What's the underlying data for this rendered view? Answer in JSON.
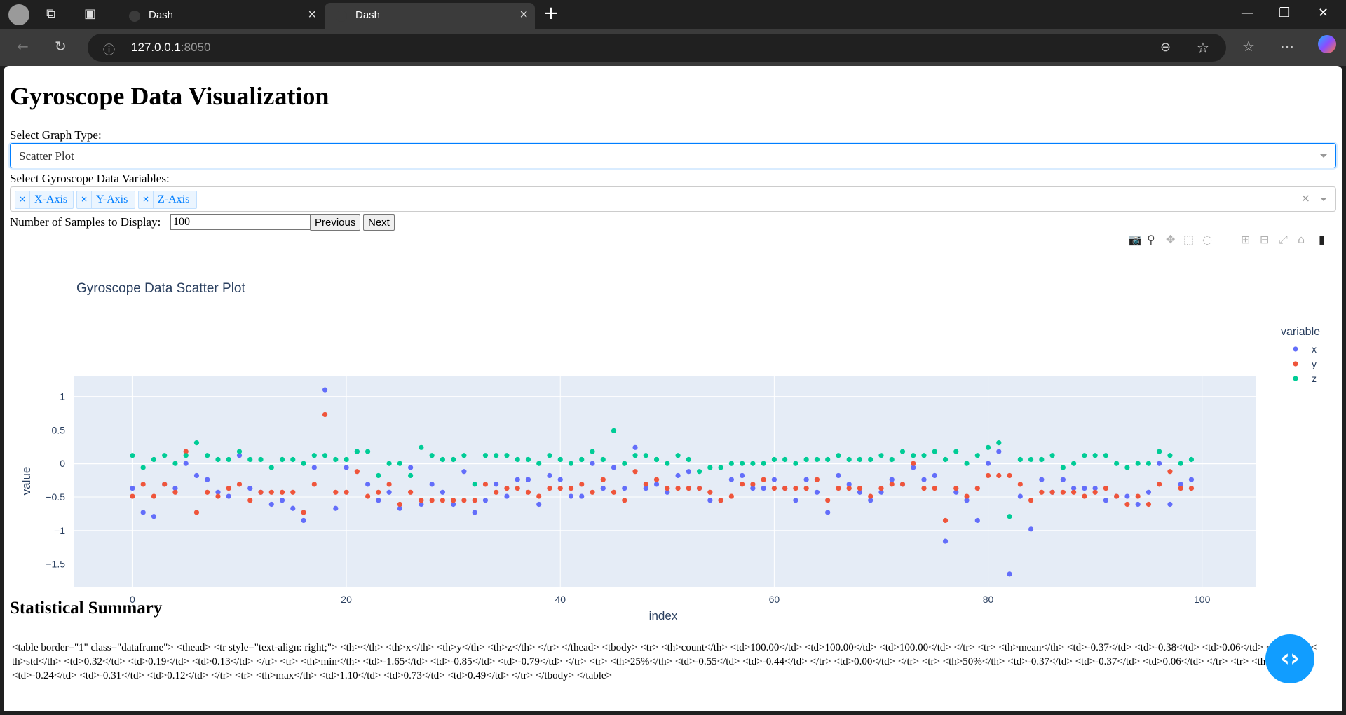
{
  "browser": {
    "tabs": [
      {
        "label": "Dash"
      },
      {
        "label": "Dash"
      }
    ],
    "url_host": "127.0.0.1",
    "url_port": ":8050"
  },
  "page": {
    "title": "Gyroscope Data Visualization",
    "graph_type_label": "Select Graph Type:",
    "graph_type_value": "Scatter Plot",
    "variables_label": "Select Gyroscope Data Variables:",
    "variables": [
      "X-Axis",
      "Y-Axis",
      "Z-Axis"
    ],
    "samples_label": "Number of Samples to Display:",
    "samples_value": "100",
    "previous_label": "Previous",
    "next_label": "Next",
    "summary_title": "Statistical Summary",
    "summary_raw": "<table border=\"1\" class=\"dataframe\"> <thead> <tr style=\"text-align: right;\"> <th></th> <th>x</th> <th>y</th> <th>z</th> </tr> </thead> <tbody> <tr> <th>count</th> <td>100.00</td> <td>100.00</td> <td>100.00</td> </tr> <tr> <th>mean</th> <td>-0.37</td> <td>-0.38</td> <td>0.06</td> </tr> <tr> <th>std</th> <td>0.32</td> <td>0.19</td> <td>0.13</td> </tr> <tr> <th>min</th> <td>-1.65</td> <td>-0.85</td> <td>-0.79</td> </tr> <tr> <th>25%</th> <td>-0.55</td> <td>-0.44</td> </tr> <td>0.00</td> </tr> <tr> <th>50%</th> <td>-0.37</td> <td>-0.37</td> <td>0.06</td> </tr> <tr> <th>75%</th> <td>-0.24</td> <td>-0.31</td> <td>0.12</td> </tr> <tr> <th>max</th> <td>1.10</td> <td>0.73</td> <td>0.49</td> </tr> </tbody> </table>"
  },
  "chart_data": {
    "type": "scatter",
    "title": "Gyroscope Data Scatter Plot",
    "xlabel": "index",
    "ylabel": "value",
    "xlim": [
      -5.5,
      105
    ],
    "ylim": [
      -1.85,
      1.3
    ],
    "xticks": [
      0,
      20,
      40,
      60,
      80,
      100
    ],
    "yticks": [
      1,
      0.5,
      0,
      -0.5,
      -1,
      -1.5
    ],
    "ytick_labels": [
      "1",
      "0.5",
      "0",
      "−0.5",
      "−1",
      "−1.5"
    ],
    "legend_title": "variable",
    "legend_position": "right",
    "grid": true,
    "colors": {
      "x": "#636efa",
      "y": "#ef553b",
      "z": "#00cc96",
      "plot_bg": "#e5ecf6"
    },
    "x": [
      0,
      1,
      2,
      3,
      4,
      5,
      6,
      7,
      8,
      9,
      10,
      11,
      12,
      13,
      14,
      15,
      16,
      17,
      18,
      19,
      20,
      21,
      22,
      23,
      24,
      25,
      26,
      27,
      28,
      29,
      30,
      31,
      32,
      33,
      34,
      35,
      36,
      37,
      38,
      39,
      40,
      41,
      42,
      43,
      44,
      45,
      46,
      47,
      48,
      49,
      50,
      51,
      52,
      53,
      54,
      55,
      56,
      57,
      58,
      59,
      60,
      61,
      62,
      63,
      64,
      65,
      66,
      67,
      68,
      69,
      70,
      71,
      72,
      73,
      74,
      75,
      76,
      77,
      78,
      79,
      80,
      81,
      82,
      83,
      84,
      85,
      86,
      87,
      88,
      89,
      90,
      91,
      92,
      93,
      94,
      95,
      96,
      97,
      98,
      99
    ],
    "series": [
      {
        "name": "x",
        "values": [
          -0.37,
          -0.73,
          -0.79,
          -0.31,
          -0.37,
          0.0,
          -0.18,
          -0.24,
          -0.43,
          -0.49,
          0.12,
          -0.37,
          -0.43,
          -0.61,
          -0.55,
          -0.67,
          -0.85,
          -0.06,
          1.1,
          -0.67,
          -0.06,
          0.18,
          -0.31,
          -0.55,
          -0.43,
          -0.67,
          -0.06,
          -0.61,
          -0.31,
          -0.43,
          -0.61,
          -0.12,
          -0.73,
          -0.55,
          -0.31,
          -0.49,
          -0.24,
          -0.24,
          -0.61,
          -0.18,
          -0.24,
          -0.49,
          -0.49,
          0.0,
          -0.37,
          -0.06,
          -0.37,
          0.24,
          -0.37,
          -0.31,
          -0.43,
          -0.18,
          -0.12,
          -0.37,
          -0.55,
          -0.55,
          -0.24,
          -0.18,
          -0.37,
          -0.37,
          -0.24,
          -0.37,
          -0.55,
          -0.24,
          -0.43,
          -0.73,
          -0.18,
          -0.31,
          -0.43,
          -0.55,
          -0.43,
          -0.24,
          -0.31,
          -0.06,
          -0.24,
          -0.18,
          -1.16,
          -0.43,
          -0.55,
          -0.85,
          0.0,
          0.18,
          -1.65,
          -0.49,
          -0.98,
          -0.24,
          -0.43,
          -0.24,
          -0.37,
          -0.37,
          -0.37,
          -0.55,
          -0.49,
          -0.49,
          -0.61,
          -0.43,
          0.0,
          -0.61,
          -0.31,
          -0.24
        ]
      },
      {
        "name": "y",
        "values": [
          -0.49,
          -0.31,
          -0.49,
          -0.31,
          -0.43,
          0.18,
          -0.73,
          -0.43,
          -0.49,
          -0.37,
          -0.31,
          -0.55,
          -0.43,
          -0.43,
          -0.43,
          -0.43,
          -0.73,
          -0.31,
          0.73,
          -0.43,
          -0.43,
          -0.12,
          -0.49,
          -0.43,
          -0.31,
          -0.61,
          -0.43,
          -0.55,
          -0.55,
          -0.55,
          -0.55,
          -0.55,
          -0.55,
          -0.31,
          -0.43,
          -0.37,
          -0.37,
          -0.43,
          -0.49,
          -0.37,
          -0.37,
          -0.37,
          -0.31,
          -0.43,
          -0.24,
          -0.43,
          -0.55,
          -0.12,
          -0.31,
          -0.24,
          -0.37,
          -0.37,
          -0.37,
          -0.37,
          -0.43,
          -0.55,
          -0.49,
          -0.31,
          -0.31,
          -0.24,
          -0.37,
          -0.37,
          -0.37,
          -0.37,
          -0.24,
          -0.55,
          -0.37,
          -0.37,
          -0.37,
          -0.49,
          -0.37,
          -0.31,
          -0.31,
          0.0,
          -0.37,
          -0.37,
          -0.85,
          -0.37,
          -0.49,
          -0.37,
          -0.18,
          -0.18,
          -0.18,
          -0.31,
          -0.55,
          -0.43,
          -0.43,
          -0.43,
          -0.43,
          -0.49,
          -0.43,
          -0.37,
          -0.49,
          -0.61,
          -0.49,
          -0.61,
          -0.31,
          -0.12,
          -0.37,
          -0.37
        ]
      },
      {
        "name": "z",
        "values": [
          0.12,
          -0.06,
          0.06,
          0.12,
          0.0,
          0.12,
          0.31,
          0.12,
          0.06,
          0.06,
          0.18,
          0.06,
          0.06,
          -0.06,
          0.06,
          0.06,
          0.0,
          0.12,
          0.12,
          0.06,
          0.06,
          0.18,
          0.18,
          -0.18,
          0.0,
          0.0,
          -0.18,
          0.24,
          0.12,
          0.06,
          0.06,
          0.12,
          -0.31,
          0.12,
          0.12,
          0.12,
          0.06,
          0.06,
          0.0,
          0.12,
          0.06,
          0.0,
          0.06,
          0.18,
          0.06,
          0.49,
          0.0,
          0.12,
          0.12,
          0.06,
          0.0,
          0.12,
          0.06,
          -0.12,
          -0.06,
          -0.06,
          0.0,
          0.0,
          0.0,
          0.0,
          0.06,
          0.06,
          0.0,
          0.06,
          0.06,
          0.06,
          0.12,
          0.06,
          0.06,
          0.06,
          0.12,
          0.06,
          0.18,
          0.12,
          0.12,
          0.18,
          0.06,
          0.18,
          0.0,
          0.12,
          0.24,
          0.31,
          -0.79,
          0.06,
          0.06,
          0.06,
          0.12,
          -0.06,
          0.0,
          0.12,
          0.12,
          0.12,
          0.0,
          -0.06,
          0.0,
          0.0,
          0.18,
          0.12,
          0.0,
          0.06
        ]
      }
    ]
  }
}
